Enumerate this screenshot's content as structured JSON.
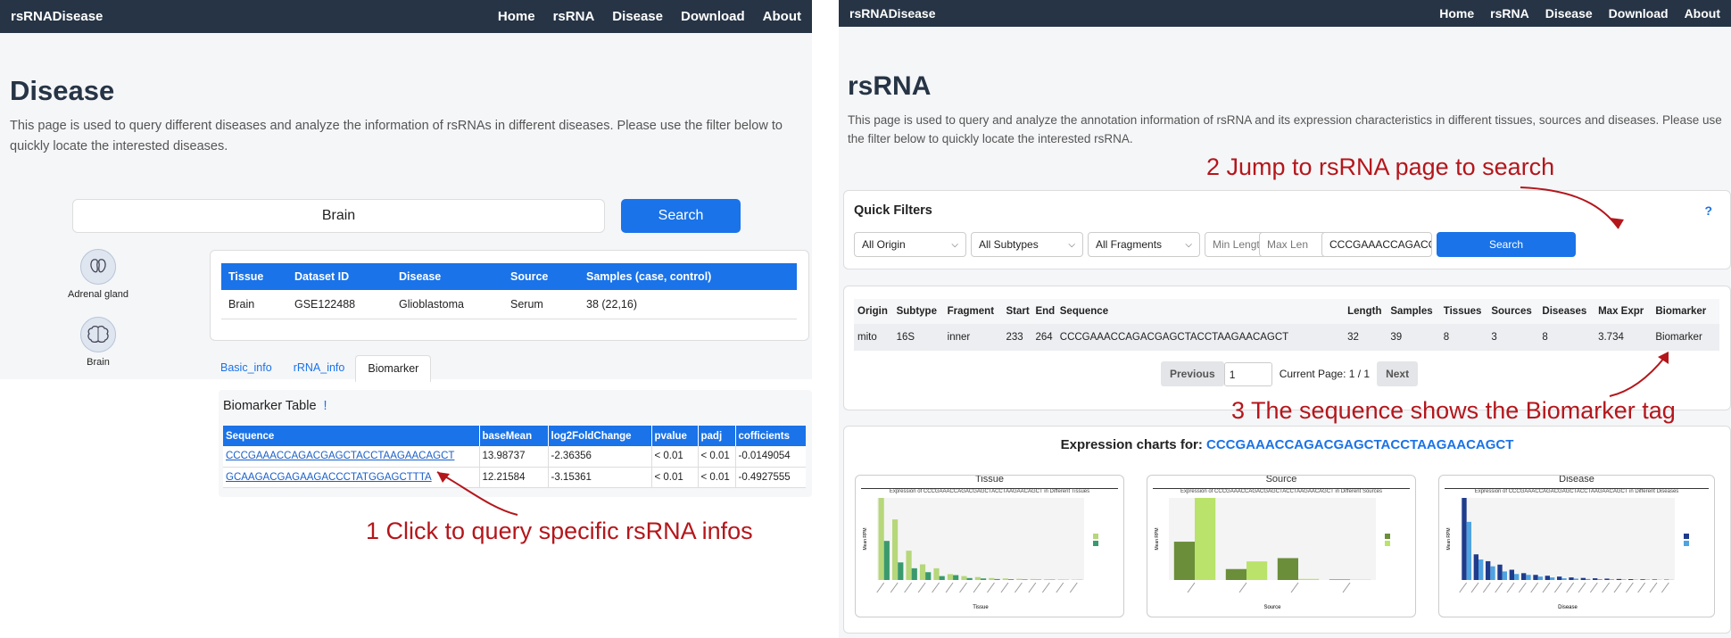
{
  "left": {
    "brand": "rsRNADisease",
    "nav": [
      "Home",
      "rsRNA",
      "Disease",
      "Download",
      "About"
    ],
    "title": "Disease",
    "description": "This page is used to query different diseases and analyze the information of rsRNAs in different diseases. Please use the filter below to quickly locate the interested diseases.",
    "search_value": "Brain",
    "search_button": "Search",
    "organs": [
      {
        "label": "Adrenal gland",
        "icon": "kidney-icon"
      },
      {
        "label": "Brain",
        "icon": "brain-icon"
      }
    ],
    "dataset_table": {
      "headers": [
        "Tissue",
        "Dataset ID",
        "Disease",
        "Source",
        "Samples (case, control)"
      ],
      "rows": [
        [
          "Brain",
          "GSE122488",
          "Glioblastoma",
          "Serum",
          "38 (22,16)"
        ]
      ]
    },
    "tabs": [
      "Basic_info",
      "rRNA_info",
      "Biomarker"
    ],
    "biomarker_title": "Biomarker Table",
    "biomarker_mark": "!",
    "biomarker_table": {
      "headers": [
        "Sequence",
        "baseMean",
        "log2FoldChange",
        "pvalue",
        "padj",
        "cofficients"
      ],
      "rows": [
        [
          "CCCGAAACCAGACGAGCTACCTAAGAACAGCT",
          "13.98737",
          "-2.36356",
          "< 0.01",
          "< 0.01",
          "-0.0149054"
        ],
        [
          "GCAAGACGAGAAGACCCTATGGAGCTTTA",
          "12.21584",
          "-3.15361",
          "< 0.01",
          "< 0.01",
          "-0.4927555"
        ]
      ]
    },
    "annotation": "1 Click to query specific rsRNA infos"
  },
  "right": {
    "brand": "rsRNADisease",
    "nav": [
      "Home",
      "rsRNA",
      "Disease",
      "Download",
      "About"
    ],
    "title": "rsRNA",
    "description": "This page is used to query and analyze the annotation information of rsRNA and its expression characteristics in different tissues, sources and diseases. Please use the filter below to quickly locate the interested rsRNA.",
    "annotation2": "2 Jump to rsRNA page to search",
    "quick_filters": "Quick Filters",
    "help": "?",
    "filters": {
      "origin": "All Origin",
      "subtypes": "All Subtypes",
      "fragments": "All Fragments",
      "min_len": "Min Length",
      "max_len": "Max Len",
      "sequence": "CCCGAAACCAGACGAG",
      "search": "Search"
    },
    "result_table": {
      "headers": [
        "Origin",
        "Subtype",
        "Fragment",
        "Start",
        "End",
        "Sequence",
        "Length",
        "Samples",
        "Tissues",
        "Sources",
        "Diseases",
        "Max Expr",
        "Biomarker"
      ],
      "rows": [
        [
          "mito",
          "16S",
          "inner",
          "233",
          "264",
          "CCCGAAACCAGACGAGCTACCTAAGAACAGCT",
          "32",
          "39",
          "8",
          "3",
          "8",
          "3.734",
          "Biomarker"
        ]
      ]
    },
    "pagination": {
      "prev": "Previous",
      "page": "1",
      "current": "Current Page: 1 / 1",
      "next": "Next"
    },
    "annotation3": "3 The sequence shows the Biomarker tag",
    "charts_heading": "Expression charts for:",
    "charts_seq": "CCCGAAACCAGACGAGCTACCTAAGAACAGCT",
    "chart_titles": [
      "Tissue",
      "Source",
      "Disease"
    ]
  },
  "chart_data": [
    {
      "type": "bar",
      "title": "Tissue",
      "subtitle": "Expression of CCCGAAACCAGACGAGCTACCTAAGAACAGCT in Different Tissues",
      "xlabel": "Tissue",
      "ylabel": "Mean RPM",
      "series": [
        {
          "name": "",
          "color": "#b6d77a",
          "values": [
            4.2,
            3.1,
            1.5,
            0.8,
            0.6,
            0.3,
            0.2,
            0.15,
            0.1,
            0.08,
            0.06,
            0.05,
            0.04,
            0.03,
            0.02
          ]
        },
        {
          "name": "",
          "color": "#3a9a6e",
          "values": [
            2.0,
            0.9,
            0.6,
            0.4,
            0.2,
            0.25,
            0.1,
            0.08,
            0.05,
            0.04,
            0.03,
            0.02,
            0.02,
            0.01,
            0.01
          ]
        }
      ]
    },
    {
      "type": "bar",
      "title": "Source",
      "subtitle": "Expression of CCCGAAACCAGACGAGCTACCTAAGAACAGCT in Different Sources",
      "xlabel": "Source",
      "ylabel": "Mean RPM",
      "series": [
        {
          "name": "",
          "color": "#6b8e3a",
          "values": [
            3.5,
            1.0,
            2.0,
            0.05
          ]
        },
        {
          "name": "",
          "color": "#b9e36a",
          "values": [
            7.5,
            1.7,
            0.1,
            0.03
          ]
        }
      ]
    },
    {
      "type": "bar",
      "title": "Disease",
      "subtitle": "Expression of CCCGAAACCAGACGAGCTACCTAAGAACAGCT in Different Diseases",
      "xlabel": "Disease",
      "ylabel": "Mean RPM",
      "series": [
        {
          "name": "",
          "color": "#1f3b8c",
          "values": [
            4.8,
            1.5,
            1.1,
            0.9,
            0.6,
            0.4,
            0.3,
            0.25,
            0.2,
            0.15,
            0.12,
            0.1,
            0.08,
            0.06,
            0.05,
            0.04,
            0.03,
            0.02
          ]
        },
        {
          "name": "",
          "color": "#4fa3e0",
          "values": [
            3.4,
            1.2,
            0.8,
            0.5,
            0.35,
            0.3,
            0.2,
            0.15,
            0.1,
            0.08,
            0.06,
            0.05,
            0.04,
            0.03,
            0.02,
            0.02,
            0.01,
            0.01
          ]
        }
      ]
    }
  ]
}
